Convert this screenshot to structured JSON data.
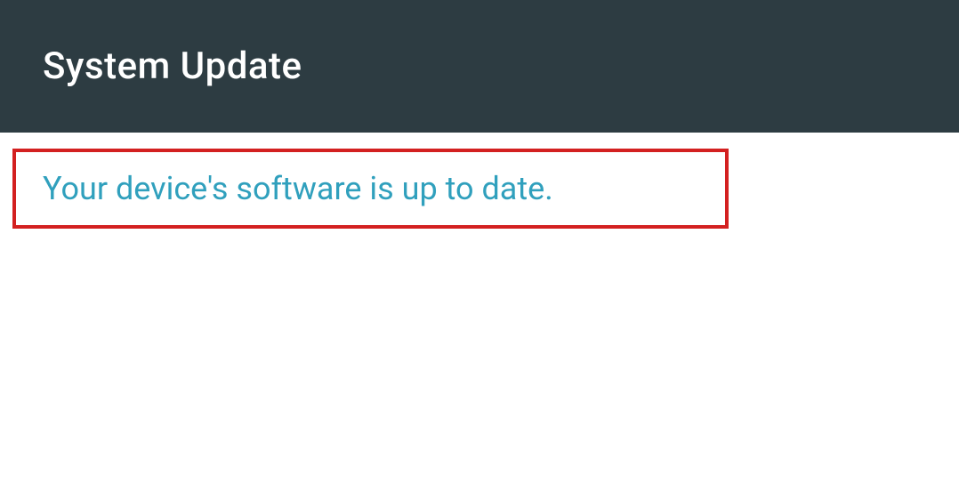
{
  "header": {
    "title": "System Update"
  },
  "status": {
    "message": "Your device's software is up to date."
  }
}
